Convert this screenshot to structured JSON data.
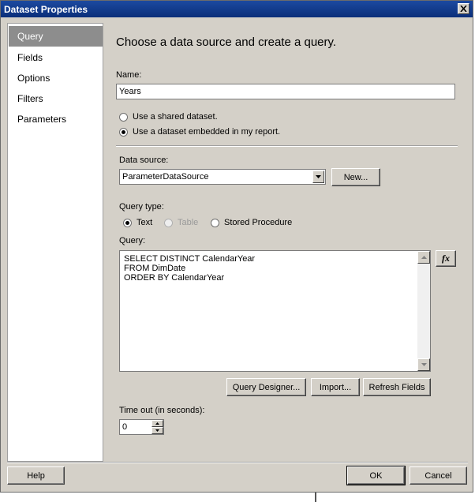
{
  "window": {
    "title": "Dataset Properties"
  },
  "nav": {
    "items": [
      {
        "label": "Query",
        "selected": true
      },
      {
        "label": "Fields"
      },
      {
        "label": "Options"
      },
      {
        "label": "Filters"
      },
      {
        "label": "Parameters"
      }
    ]
  },
  "main": {
    "heading": "Choose a data source and create a query.",
    "name_label": "Name:",
    "name_value": "Years",
    "radio_shared": "Use a shared dataset.",
    "radio_embedded": "Use a dataset embedded in my report.",
    "datasource_label": "Data source:",
    "datasource_value": "ParameterDataSource",
    "new_button": "New...",
    "querytype_label": "Query type:",
    "qt_text": "Text",
    "qt_table": "Table",
    "qt_stored": "Stored Procedure",
    "query_label": "Query:",
    "query_lines": [
      "SELECT DISTINCT CalendarYear",
      "FROM DimDate",
      "ORDER BY CalendarYear"
    ],
    "fx_label": "fx",
    "query_designer_button": "Query Designer...",
    "import_button": "Import...",
    "refresh_button": "Refresh Fields",
    "timeout_label": "Time out (in seconds):",
    "timeout_value": "0"
  },
  "footer": {
    "help": "Help",
    "ok": "OK",
    "cancel": "Cancel"
  }
}
